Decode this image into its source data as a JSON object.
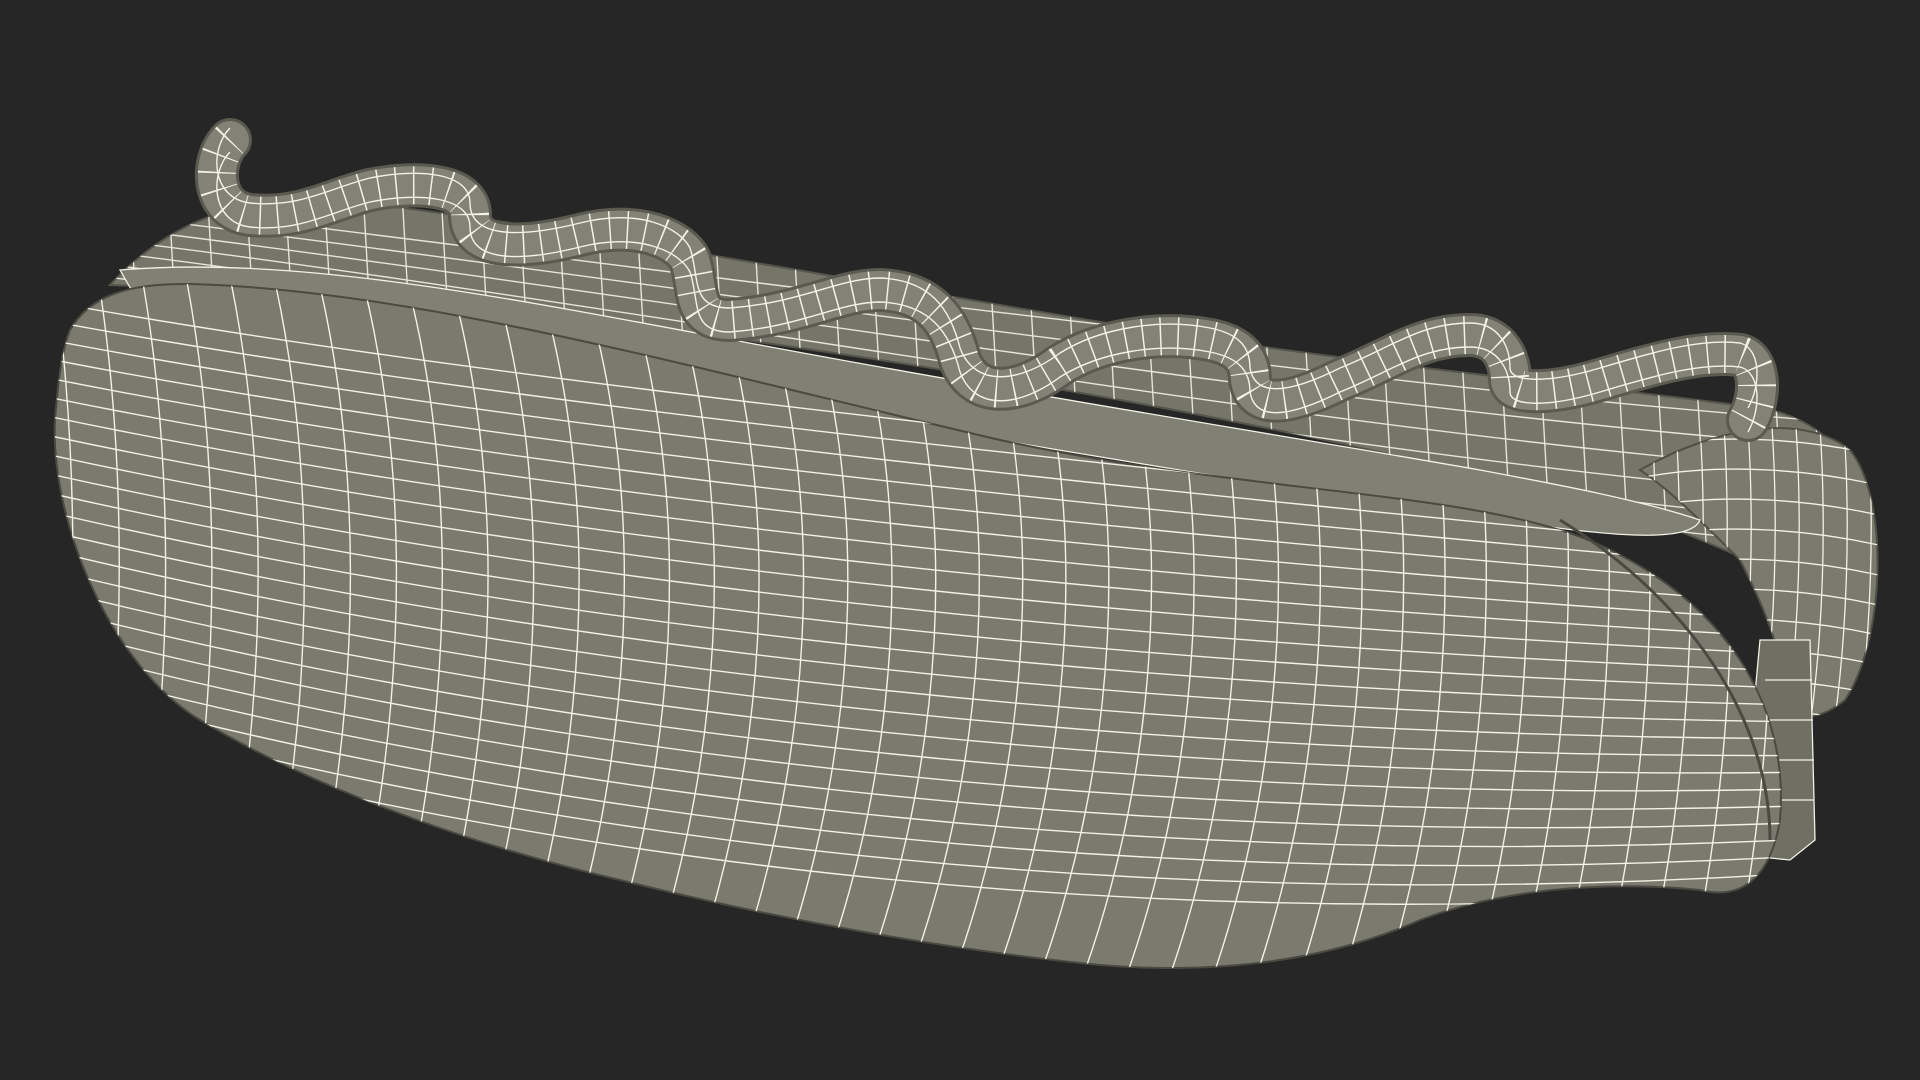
{
  "scene": {
    "subject": "hotdog-wireframe-render",
    "colors": {
      "background": "#262626",
      "surface_main": "#7c7c70",
      "surface_light": "#868679",
      "surface_shadow": "#6b6b60",
      "wire": "#f2f2e6",
      "edge_dark": "#4a4a42"
    }
  }
}
